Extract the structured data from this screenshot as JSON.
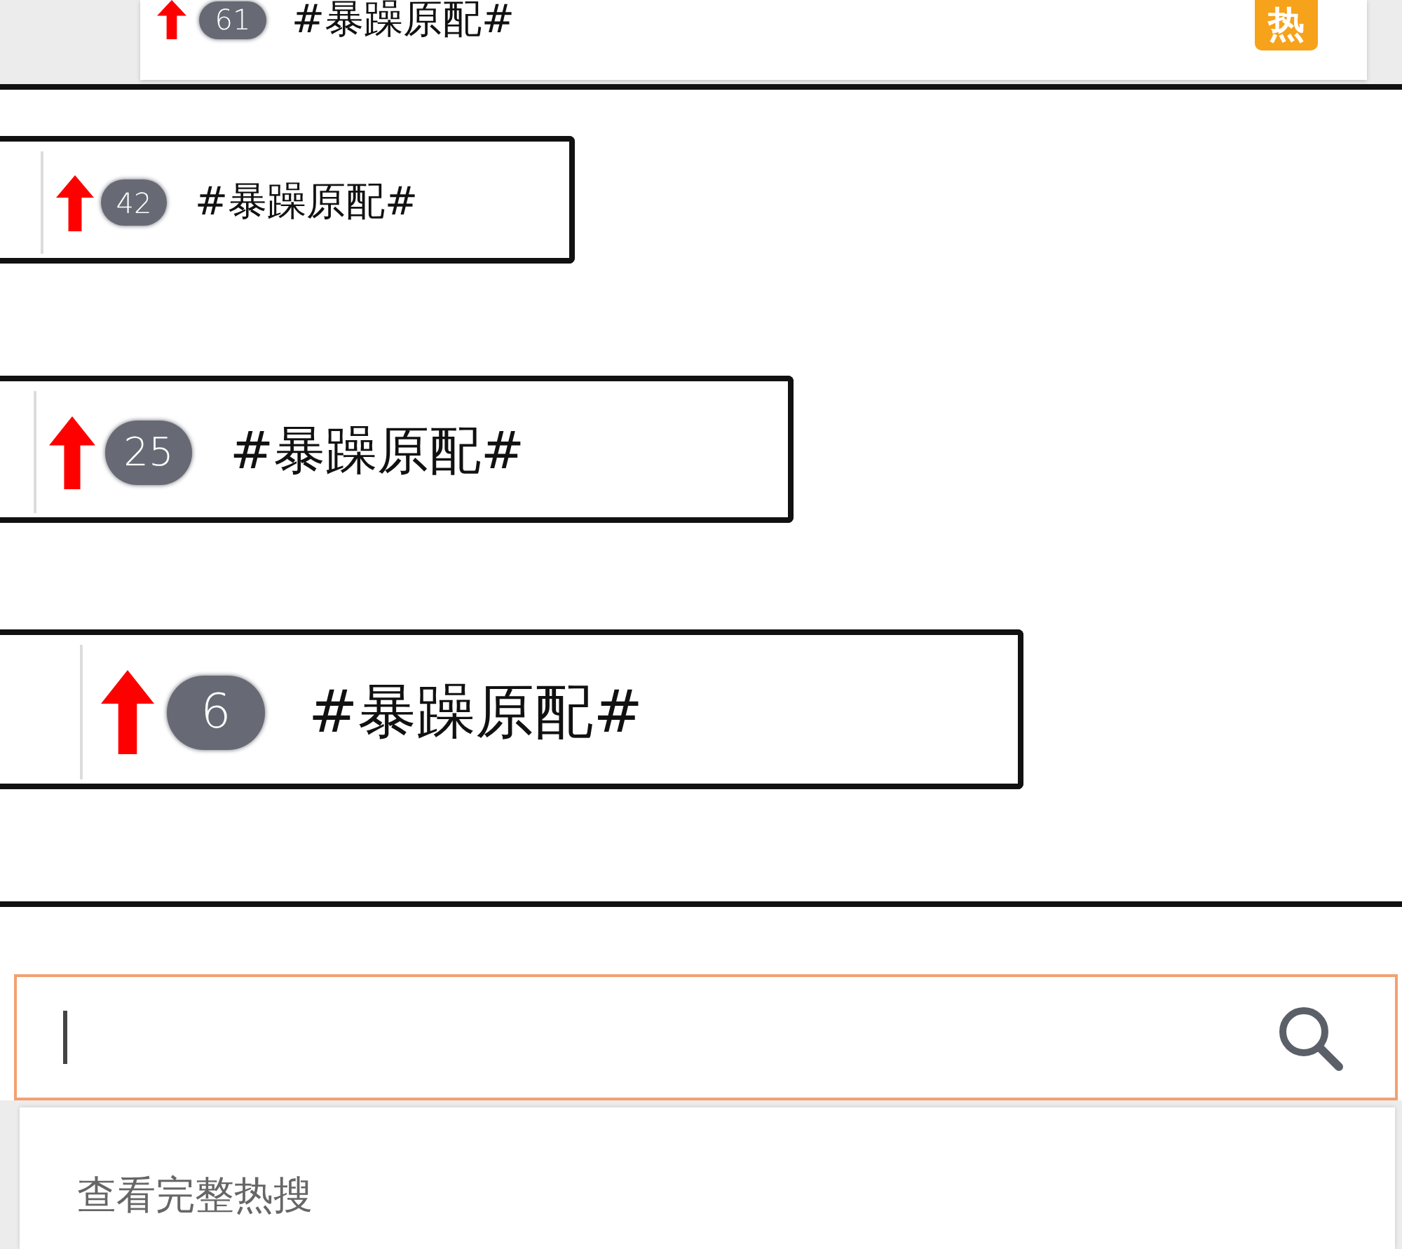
{
  "top_item": {
    "rising": true,
    "rank": "61",
    "title": "#暴躁原配#",
    "tag": "热"
  },
  "zoom_panels": [
    {
      "rising": true,
      "rank": "42",
      "title": "#暴躁原配#"
    },
    {
      "rising": true,
      "rank": "25",
      "title": "#暴躁原配#"
    },
    {
      "rising": true,
      "rank": "6",
      "title": "#暴躁原配#"
    }
  ],
  "search": {
    "focused": true
  },
  "dropdown": {
    "link": "查看完整热搜"
  }
}
